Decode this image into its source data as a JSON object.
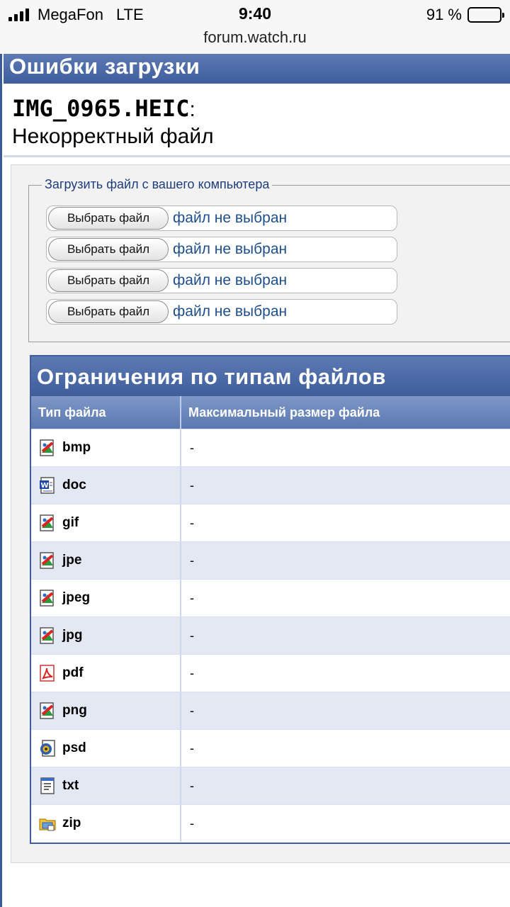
{
  "status_bar": {
    "carrier": "MegaFon",
    "network": "LTE",
    "time": "9:40",
    "battery_text": "91 %",
    "battery_level": 0.91
  },
  "url": "forum.watch.ru",
  "error": {
    "heading": "Ошибки загрузки",
    "filename": "IMG_0965.HEIC",
    "separator": ":",
    "message": "Некорректный файл"
  },
  "upload": {
    "legend": "Загрузить файл с вашего компьютера",
    "rows": [
      {
        "button": "Выбрать файл",
        "status": "файл не выбран"
      },
      {
        "button": "Выбрать файл",
        "status": "файл не выбран"
      },
      {
        "button": "Выбрать файл",
        "status": "файл не выбран"
      },
      {
        "button": "Выбрать файл",
        "status": "файл не выбран"
      }
    ]
  },
  "limits": {
    "heading": "Ограничения по типам файлов",
    "col_type": "Тип файла",
    "col_size": "Максимальный размер файла",
    "rows": [
      {
        "ext": "bmp",
        "size": "-",
        "icon": "image-file-icon"
      },
      {
        "ext": "doc",
        "size": "-",
        "icon": "word-file-icon"
      },
      {
        "ext": "gif",
        "size": "-",
        "icon": "image-file-icon"
      },
      {
        "ext": "jpe",
        "size": "-",
        "icon": "image-file-icon"
      },
      {
        "ext": "jpeg",
        "size": "-",
        "icon": "image-file-icon"
      },
      {
        "ext": "jpg",
        "size": "-",
        "icon": "image-file-icon"
      },
      {
        "ext": "pdf",
        "size": "-",
        "icon": "pdf-file-icon"
      },
      {
        "ext": "png",
        "size": "-",
        "icon": "image-file-icon"
      },
      {
        "ext": "psd",
        "size": "-",
        "icon": "psd-file-icon"
      },
      {
        "ext": "txt",
        "size": "-",
        "icon": "text-file-icon"
      },
      {
        "ext": "zip",
        "size": "-",
        "icon": "zip-file-icon"
      }
    ]
  },
  "colors": {
    "header_blue": "#3e5d9a",
    "link_blue": "#1e4f8a"
  }
}
